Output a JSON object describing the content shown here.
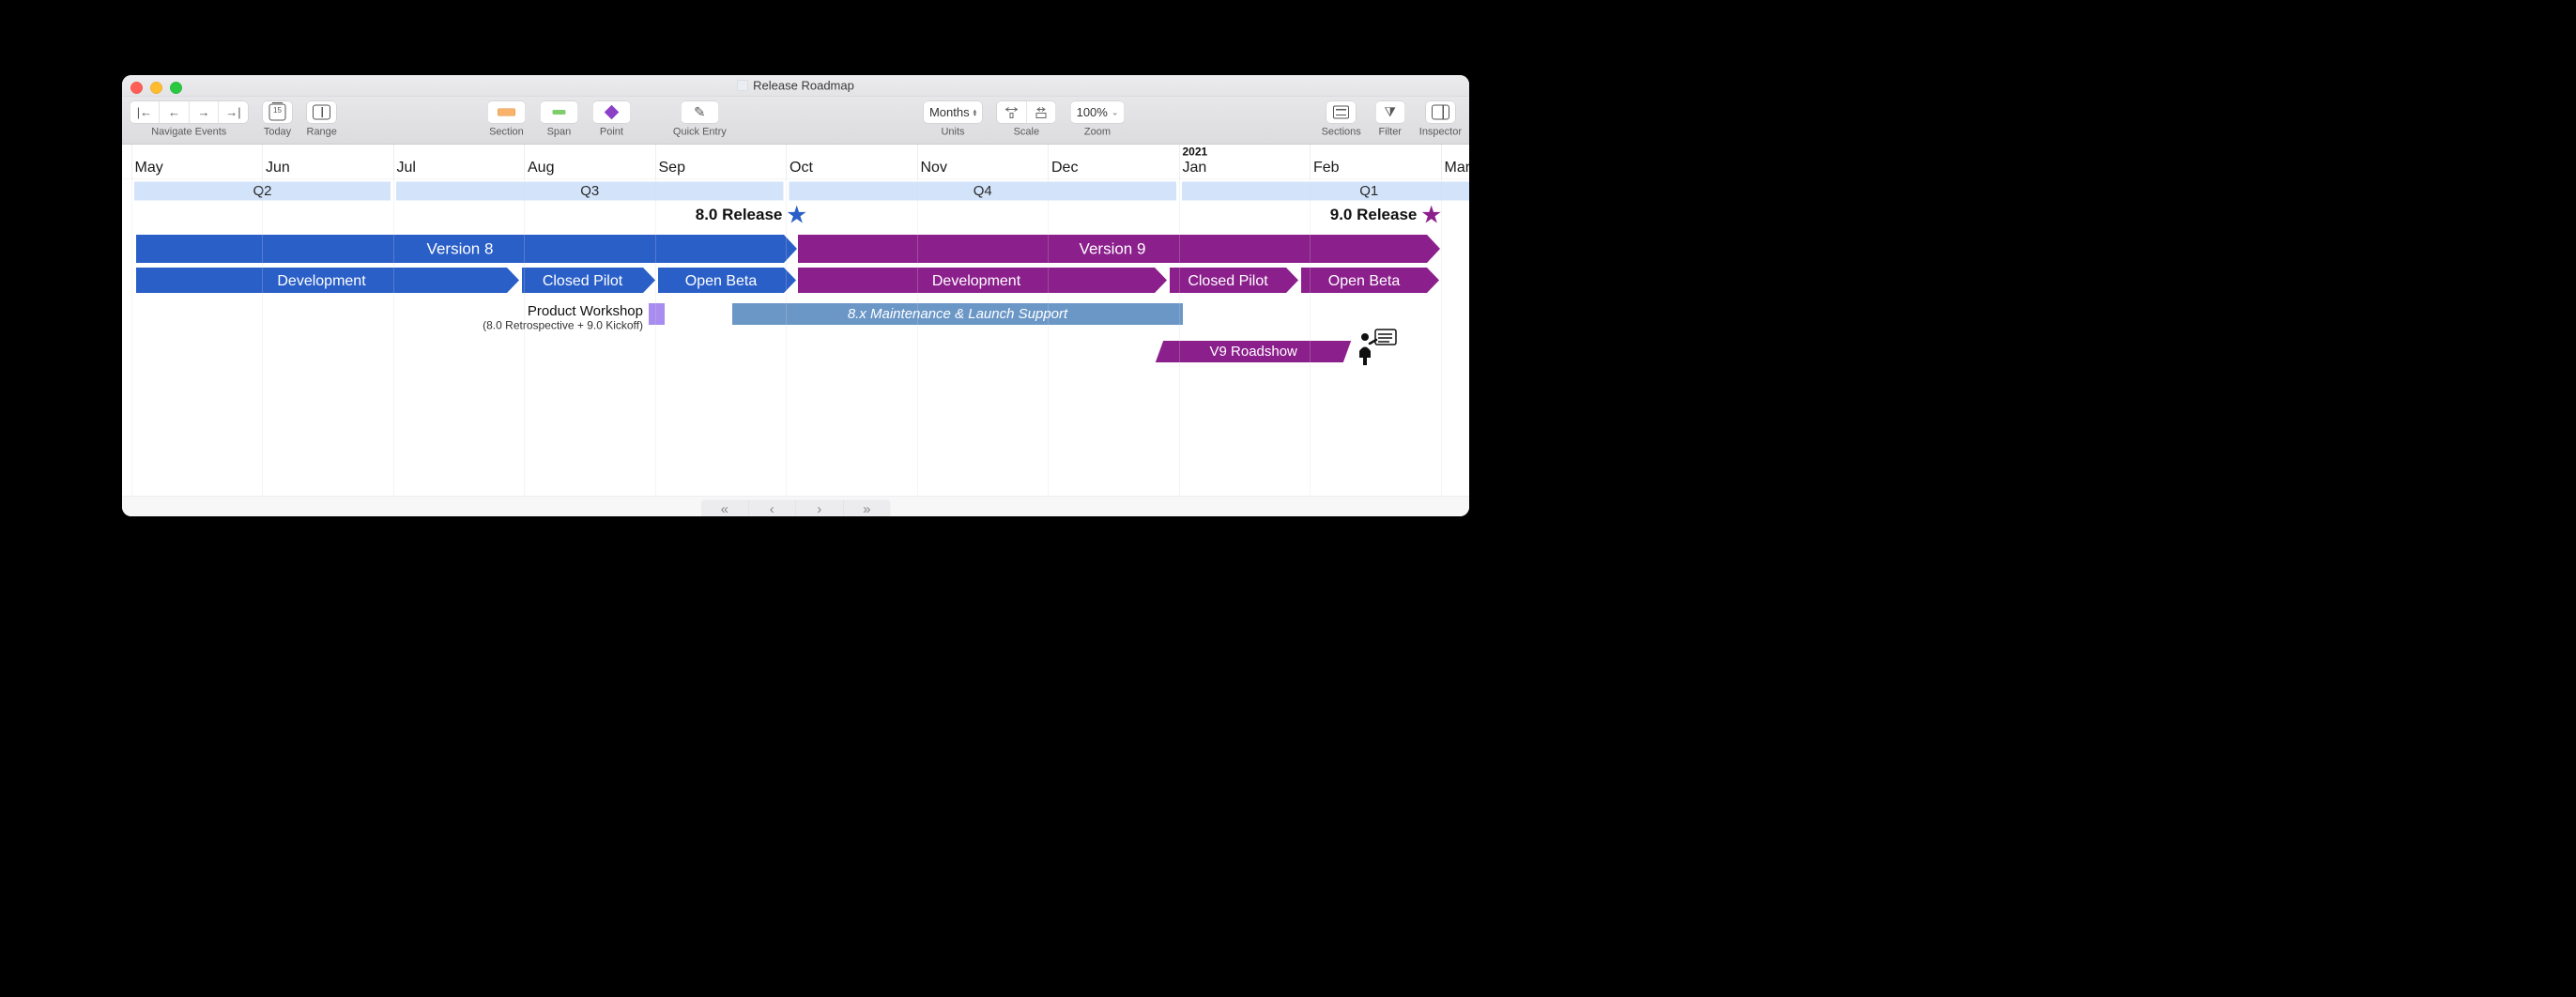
{
  "window": {
    "title": "Release Roadmap"
  },
  "toolbar": {
    "navigate_label": "Navigate Events",
    "today_label": "Today",
    "range_label": "Range",
    "section_label": "Section",
    "span_label": "Span",
    "point_label": "Point",
    "quick_label": "Quick Entry",
    "units_label": "Units",
    "units_value": "Months",
    "scale_label": "Scale",
    "zoom_label": "Zoom",
    "zoom_value": "100%",
    "sections_label": "Sections",
    "filter_label": "Filter",
    "inspector_label": "Inspector"
  },
  "timeline": {
    "year_marker": "2021",
    "months": [
      "May",
      "Jun",
      "Jul",
      "Aug",
      "Sep",
      "Oct",
      "Nov",
      "Dec",
      "Jan",
      "Feb",
      "Mar"
    ],
    "quarters": [
      "Q2",
      "Q3",
      "Q4",
      "Q1"
    ]
  },
  "milestones": {
    "r8": "8.0 Release",
    "r9": "9.0 Release"
  },
  "versions": {
    "v8": "Version 8",
    "v9": "Version 9"
  },
  "phases": {
    "dev": "Development",
    "pilot": "Closed Pilot",
    "beta": "Open Beta"
  },
  "workshop": {
    "title": "Product Workshop",
    "subtitle": "(8.0 Retrospective + 9.0 Kickoff)"
  },
  "maintenance": "8.x Maintenance & Launch Support",
  "roadshow": "V9 Roadshow",
  "colors": {
    "blue": "#2a5fc7",
    "purple": "#8b1f8c",
    "steel": "#6b97c7",
    "lavender": "#a88cf0",
    "pale_blue": "#d3e4fa"
  },
  "chart_data": {
    "type": "gantt",
    "x_axis": {
      "unit": "month",
      "start": "2020-05",
      "end": "2021-03",
      "ticks": [
        "May",
        "Jun",
        "Jul",
        "Aug",
        "Sep",
        "Oct",
        "Nov",
        "Dec",
        "Jan",
        "Feb",
        "Mar"
      ]
    },
    "quarters": [
      {
        "label": "Q2",
        "start": "2020-05",
        "end": "2020-06"
      },
      {
        "label": "Q3",
        "start": "2020-07",
        "end": "2020-09"
      },
      {
        "label": "Q4",
        "start": "2020-10",
        "end": "2020-12"
      },
      {
        "label": "Q1",
        "start": "2021-01",
        "end": "2021-03"
      }
    ],
    "milestones": [
      {
        "label": "8.0 Release",
        "date": "2020-10-01",
        "color": "#2a5fc7"
      },
      {
        "label": "9.0 Release",
        "date": "2021-03-01",
        "color": "#8b1f8c"
      }
    ],
    "bars": [
      {
        "row": "version",
        "label": "Version 8",
        "start": "2020-05-05",
        "end": "2020-10-01",
        "color": "#2a5fc7"
      },
      {
        "row": "version",
        "label": "Version 9",
        "start": "2020-10-01",
        "end": "2021-03-01",
        "color": "#8b1f8c"
      },
      {
        "row": "phase-v8",
        "label": "Development",
        "start": "2020-05-05",
        "end": "2020-08-01",
        "color": "#2a5fc7"
      },
      {
        "row": "phase-v8",
        "label": "Closed Pilot",
        "start": "2020-08-01",
        "end": "2020-09-01",
        "color": "#2a5fc7"
      },
      {
        "row": "phase-v8",
        "label": "Open Beta",
        "start": "2020-09-01",
        "end": "2020-10-01",
        "color": "#2a5fc7"
      },
      {
        "row": "phase-v9",
        "label": "Development",
        "start": "2020-10-01",
        "end": "2021-01-01",
        "color": "#8b1f8c"
      },
      {
        "row": "phase-v9",
        "label": "Closed Pilot",
        "start": "2021-01-01",
        "end": "2021-02-01",
        "color": "#8b1f8c"
      },
      {
        "row": "phase-v9",
        "label": "Open Beta",
        "start": "2021-02-01",
        "end": "2021-03-01",
        "color": "#8b1f8c"
      },
      {
        "row": "support",
        "label": "Product Workshop",
        "start": "2020-08-28",
        "end": "2020-09-03",
        "color": "#a88cf0",
        "subtitle": "(8.0 Retrospective + 9.0 Kickoff)"
      },
      {
        "row": "support",
        "label": "8.x Maintenance & Launch Support",
        "start": "2020-09-18",
        "end": "2021-01-01",
        "color": "#6b97c7"
      },
      {
        "row": "events",
        "label": "V9 Roadshow",
        "start": "2020-12-28",
        "end": "2021-02-12",
        "color": "#8b1f8c"
      }
    ]
  }
}
